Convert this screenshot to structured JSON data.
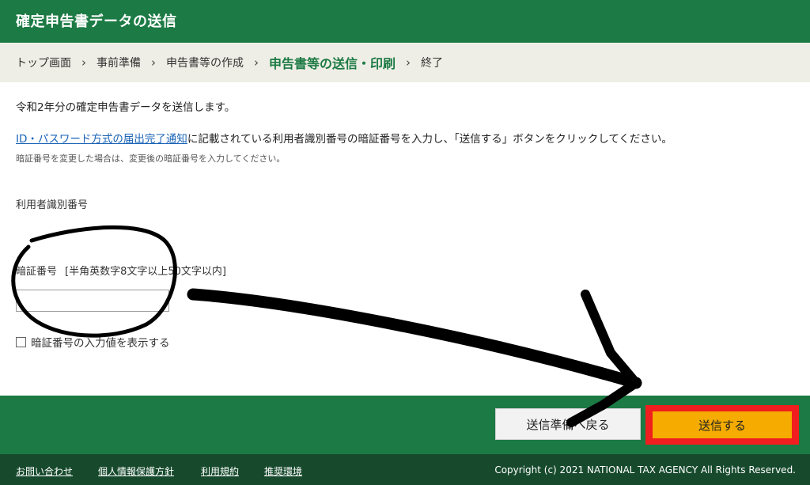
{
  "header": {
    "title": "確定申告書データの送信"
  },
  "breadcrumb": {
    "items": [
      "トップ画面",
      "事前準備",
      "申告書等の作成",
      "申告書等の送信・印刷",
      "終了"
    ],
    "separator": "›"
  },
  "main": {
    "lead": "令和2年分の確定申告書データを送信します。",
    "instruction_link": "ID・パスワード方式の届出完了通知",
    "instruction_rest": "に記載されている利用者識別番号の暗証番号を入力し、「送信する」ボタンをクリックしてください。",
    "note": "暗証番号を変更した場合は、変更後の暗証番号を入力してください。",
    "user_id_label": "利用者識別番号",
    "pin_label": "暗証番号",
    "pin_hint": "[半角英数字8文字以上50文字以内]",
    "pin_value": "",
    "show_pin_label": "暗証番号の入力値を表示する",
    "show_pin_checked": false
  },
  "actions": {
    "back_label": "送信準備へ戻る",
    "send_label": "送信する"
  },
  "footer": {
    "links": [
      "お問い合わせ",
      "個人情報保護方針",
      "利用規約",
      "推奨環境"
    ],
    "copyright": "Copyright (c) 2021 NATIONAL TAX AGENCY All Rights Reserved."
  },
  "colors": {
    "header_green": "#1c7a44",
    "footer_green": "#174a2d",
    "breadcrumb_bg": "#efeee6",
    "send_button": "#f5ab00",
    "highlight_red": "#f01e1e",
    "link_blue": "#1a63b6"
  },
  "annotations": [
    "circle-around-pin-field",
    "arrow-to-send-button"
  ]
}
